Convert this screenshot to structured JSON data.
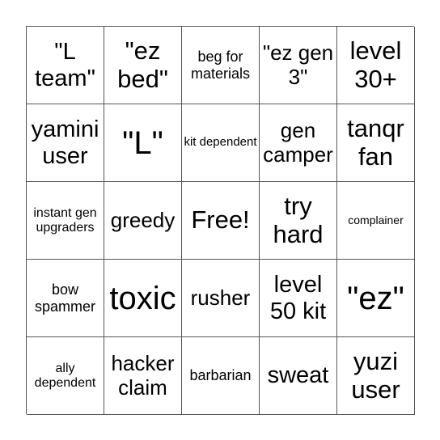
{
  "cells": [
    {
      "text": "\"L team\"",
      "size": "s30"
    },
    {
      "text": "\"ez bed\"",
      "size": "s32"
    },
    {
      "text": "beg for materials",
      "size": "s18"
    },
    {
      "text": "\"ez gen 3\"",
      "size": "s26"
    },
    {
      "text": "level 30+",
      "size": "s32"
    },
    {
      "text": "yamini user",
      "size": "s30"
    },
    {
      "text": "\"L\"",
      "size": "s40"
    },
    {
      "text": "kit dependent",
      "size": "s15"
    },
    {
      "text": "gen camper",
      "size": "s26"
    },
    {
      "text": "tanqr fan",
      "size": "s32"
    },
    {
      "text": "instant gen upgraders",
      "size": "s16"
    },
    {
      "text": "greedy",
      "size": "s26"
    },
    {
      "text": "Free!",
      "size": "s32"
    },
    {
      "text": "try hard",
      "size": "s32"
    },
    {
      "text": "complainer",
      "size": "s14"
    },
    {
      "text": "bow spammer",
      "size": "s18"
    },
    {
      "text": "toxic",
      "size": "s40"
    },
    {
      "text": "rusher",
      "size": "s26"
    },
    {
      "text": "level 50 kit",
      "size": "s30"
    },
    {
      "text": "\"ez\"",
      "size": "s40"
    },
    {
      "text": "ally dependent",
      "size": "s16"
    },
    {
      "text": "hacker claim",
      "size": "s26"
    },
    {
      "text": "barbarian",
      "size": "s18"
    },
    {
      "text": "sweat",
      "size": "s30"
    },
    {
      "text": "yuzi user",
      "size": "s32"
    }
  ]
}
